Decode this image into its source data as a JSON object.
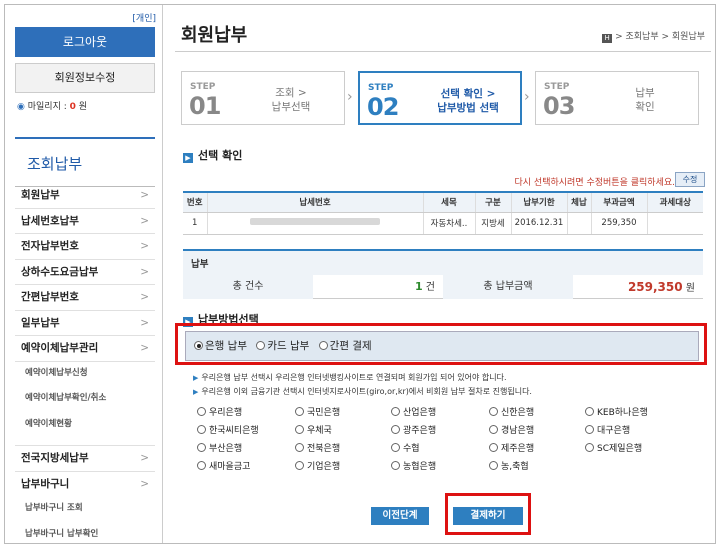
{
  "sidebar": {
    "personal": "[개인]",
    "logout": "로그아웃",
    "profile_edit": "회원정보수정",
    "mileage_label": "마일리지 :",
    "mileage_value": "0",
    "mileage_unit": "원",
    "section_title": "조회납부",
    "items": [
      {
        "label": "회원납부"
      },
      {
        "label": "납세번호납부"
      },
      {
        "label": "전자납부번호"
      },
      {
        "label": "상하수도요금납부"
      },
      {
        "label": "간편납부번호"
      },
      {
        "label": "일부납부"
      },
      {
        "label": "예약이체납부관리"
      }
    ],
    "auto_sub": [
      "예약이체납부신청",
      "예약이체납부확인/취소",
      "예약이체현황"
    ],
    "items2": [
      {
        "label": "전국지방세납부"
      },
      {
        "label": "납부바구니"
      }
    ],
    "cart_sub": [
      "납부바구니 조회",
      "납부바구니 납부확인"
    ],
    "arrow": ">"
  },
  "header": {
    "title": "회원납부",
    "breadcrumb_home": "H",
    "breadcrumb": "> 조회납부 > 회원납부"
  },
  "steps": [
    {
      "label": "STEP",
      "num": "01",
      "text": "조회 >\n납부선택"
    },
    {
      "label": "STEP",
      "num": "02",
      "text": "선택 확인 >\n납부방법 선택"
    },
    {
      "label": "STEP",
      "num": "03",
      "text": "납부\n확인"
    }
  ],
  "selection": {
    "heading": "선택 확인",
    "notice": "다시 선택하시려면 수정버튼을 클릭하세요.",
    "edit_button": "수정",
    "columns": [
      "번호",
      "납세번호",
      "세목",
      "구분",
      "납부기한",
      "체납",
      "부과금액",
      "과세대상"
    ],
    "rows": [
      {
        "no": "1",
        "tax_item": "자동차세..",
        "type": "지방세",
        "due": "2016.12.31",
        "arrears": "",
        "amount": "259,350",
        "target": ""
      }
    ]
  },
  "payment": {
    "heading": "납부",
    "count_label": "총 건수",
    "count_value": "1",
    "count_unit": "건",
    "amount_label": "총 납부금액",
    "amount_value": "259,350",
    "amount_unit": "원"
  },
  "method": {
    "heading": "납부방법선택",
    "options": [
      "은행 납부",
      "카드 납부",
      "간편 결제"
    ],
    "selected": 0,
    "notes": [
      "우리은행 납부 선택시 우리은행 인터넷뱅킹사이트로 연결되며 회원가입 되어 있어야 합니다.",
      "우리은행 이외 금융기관 선택시 인터넷지로사이트(giro,or,kr)에서 비회원 납부 절차로 진행됩니다."
    ],
    "banks": [
      [
        "우리은행",
        "국민은행",
        "산업은행",
        "신한은행",
        "KEB하나은행"
      ],
      [
        "한국씨티은행",
        "우체국",
        "광주은행",
        "경남은행",
        "대구은행"
      ],
      [
        "부산은행",
        "전북은행",
        "수협",
        "제주은행",
        "SC제일은행"
      ],
      [
        "새마을금고",
        "기업은행",
        "농협은행",
        "농,축협"
      ]
    ]
  },
  "buttons": {
    "prev": "이전단계",
    "pay": "결제하기"
  },
  "colors": {
    "accent": "#2e7fc0",
    "highlight": "#dd1111",
    "amount": "#c0392b"
  }
}
